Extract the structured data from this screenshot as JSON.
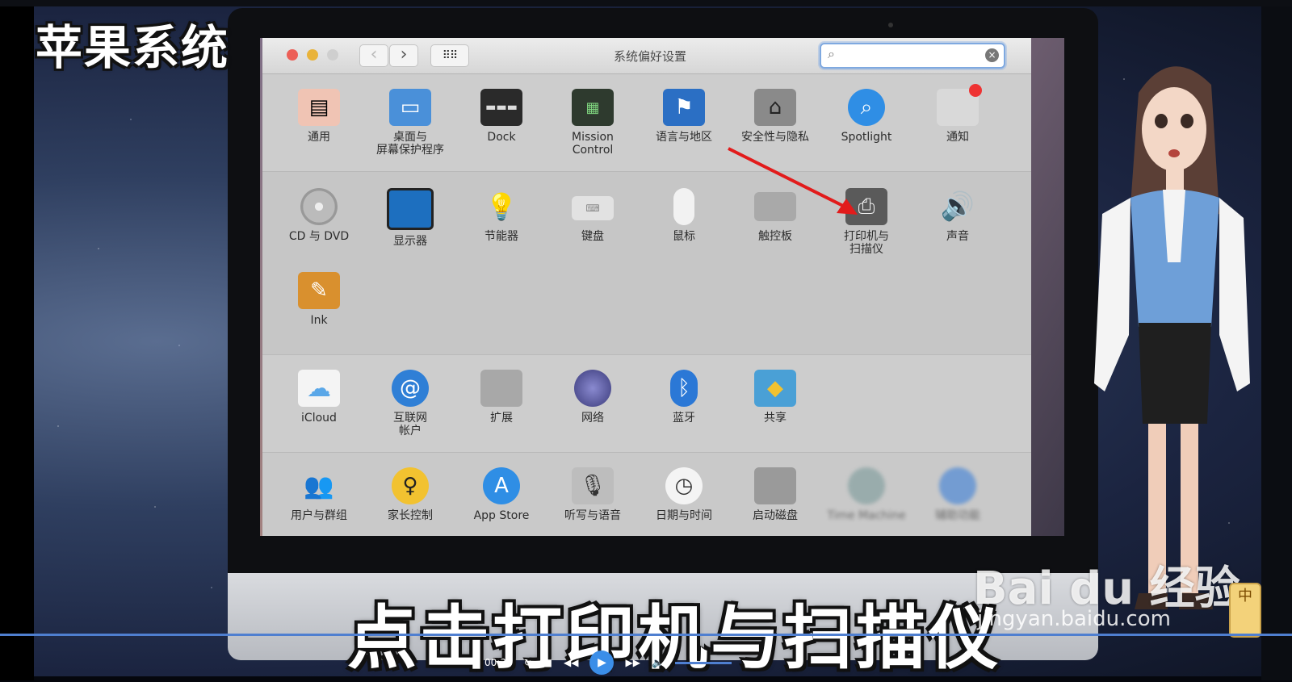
{
  "video": {
    "corner_title": "苹果系统",
    "subtitle": "点击打印机与扫描仪",
    "time": "00:30"
  },
  "window": {
    "title": "系统偏好设置",
    "search": {
      "value": "",
      "placeholder": ""
    },
    "nav": {
      "back": "‹",
      "forward": "›",
      "grid": "⠿⠿"
    }
  },
  "sections": [
    {
      "items": [
        {
          "label": "通用",
          "icon": "general-icon",
          "color": "#e8a080"
        },
        {
          "label": "桌面与\n屏幕保护程序",
          "icon": "desktop-screensaver-icon",
          "color": "#4a90d9"
        },
        {
          "label": "Dock",
          "icon": "dock-icon",
          "color": "#2a2a2a"
        },
        {
          "label": "Mission\nControl",
          "icon": "mission-control-icon",
          "color": "#3a4a3a"
        },
        {
          "label": "语言与地区",
          "icon": "language-region-icon",
          "color": "#2b6fc4"
        },
        {
          "label": "安全性与隐私",
          "icon": "security-privacy-icon",
          "color": "#6e6e6e"
        },
        {
          "label": "Spotlight",
          "icon": "spotlight-icon",
          "color": "#2f8ee5"
        },
        {
          "label": "通知",
          "icon": "notifications-icon",
          "color": "#bdbdbd"
        }
      ]
    },
    {
      "items": [
        {
          "label": "CD 与 DVD",
          "icon": "cd-dvd-icon",
          "color": "#b8b8b8"
        },
        {
          "label": "显示器",
          "icon": "displays-icon",
          "color": "#1d6fbf"
        },
        {
          "label": "节能器",
          "icon": "energy-saver-icon",
          "color": "#e8d77a"
        },
        {
          "label": "键盘",
          "icon": "keyboard-icon",
          "color": "#cfcfcf"
        },
        {
          "label": "鼠标",
          "icon": "mouse-icon",
          "color": "#e6e6e6"
        },
        {
          "label": "触控板",
          "icon": "trackpad-icon",
          "color": "#a9a9a9"
        },
        {
          "label": "打印机与\n扫描仪",
          "icon": "printer-scanner-icon",
          "color": "#5a5a5a"
        },
        {
          "label": "声音",
          "icon": "sound-icon",
          "color": "#3a3a3a"
        },
        {
          "label": "Ink",
          "icon": "ink-icon",
          "color": "#d9902e"
        }
      ]
    },
    {
      "items": [
        {
          "label": "iCloud",
          "icon": "icloud-icon",
          "color": "#5aa7e8"
        },
        {
          "label": "互联网\n帐户",
          "icon": "internet-accounts-icon",
          "color": "#2f7fd6"
        },
        {
          "label": "扩展",
          "icon": "extensions-icon",
          "color": "#a8a8a8"
        },
        {
          "label": "网络",
          "icon": "network-icon",
          "color": "#6a6aa8"
        },
        {
          "label": "蓝牙",
          "icon": "bluetooth-icon",
          "color": "#2b78d6"
        },
        {
          "label": "共享",
          "icon": "sharing-icon",
          "color": "#4aa0d6"
        }
      ]
    },
    {
      "items": [
        {
          "label": "用户与群组",
          "icon": "users-groups-icon",
          "color": "#333333"
        },
        {
          "label": "家长控制",
          "icon": "parental-controls-icon",
          "color": "#f2c230"
        },
        {
          "label": "App Store",
          "icon": "app-store-icon",
          "color": "#2f8ee5"
        },
        {
          "label": "听写与语音",
          "icon": "dictation-speech-icon",
          "color": "#9a9a9a"
        },
        {
          "label": "日期与时间",
          "icon": "date-time-icon",
          "color": "#d9d9d9"
        },
        {
          "label": "启动磁盘",
          "icon": "startup-disk-icon",
          "color": "#9a9a9a"
        },
        {
          "label": "Time Machine",
          "icon": "time-machine-icon",
          "color": "#7a9a9a"
        },
        {
          "label": "辅助功能",
          "icon": "accessibility-icon",
          "color": "#3b7fd8"
        }
      ]
    }
  ],
  "watermark": {
    "logo": "Bai du 经验",
    "url": "jingyan.baidu.com",
    "side_badge": "中"
  }
}
